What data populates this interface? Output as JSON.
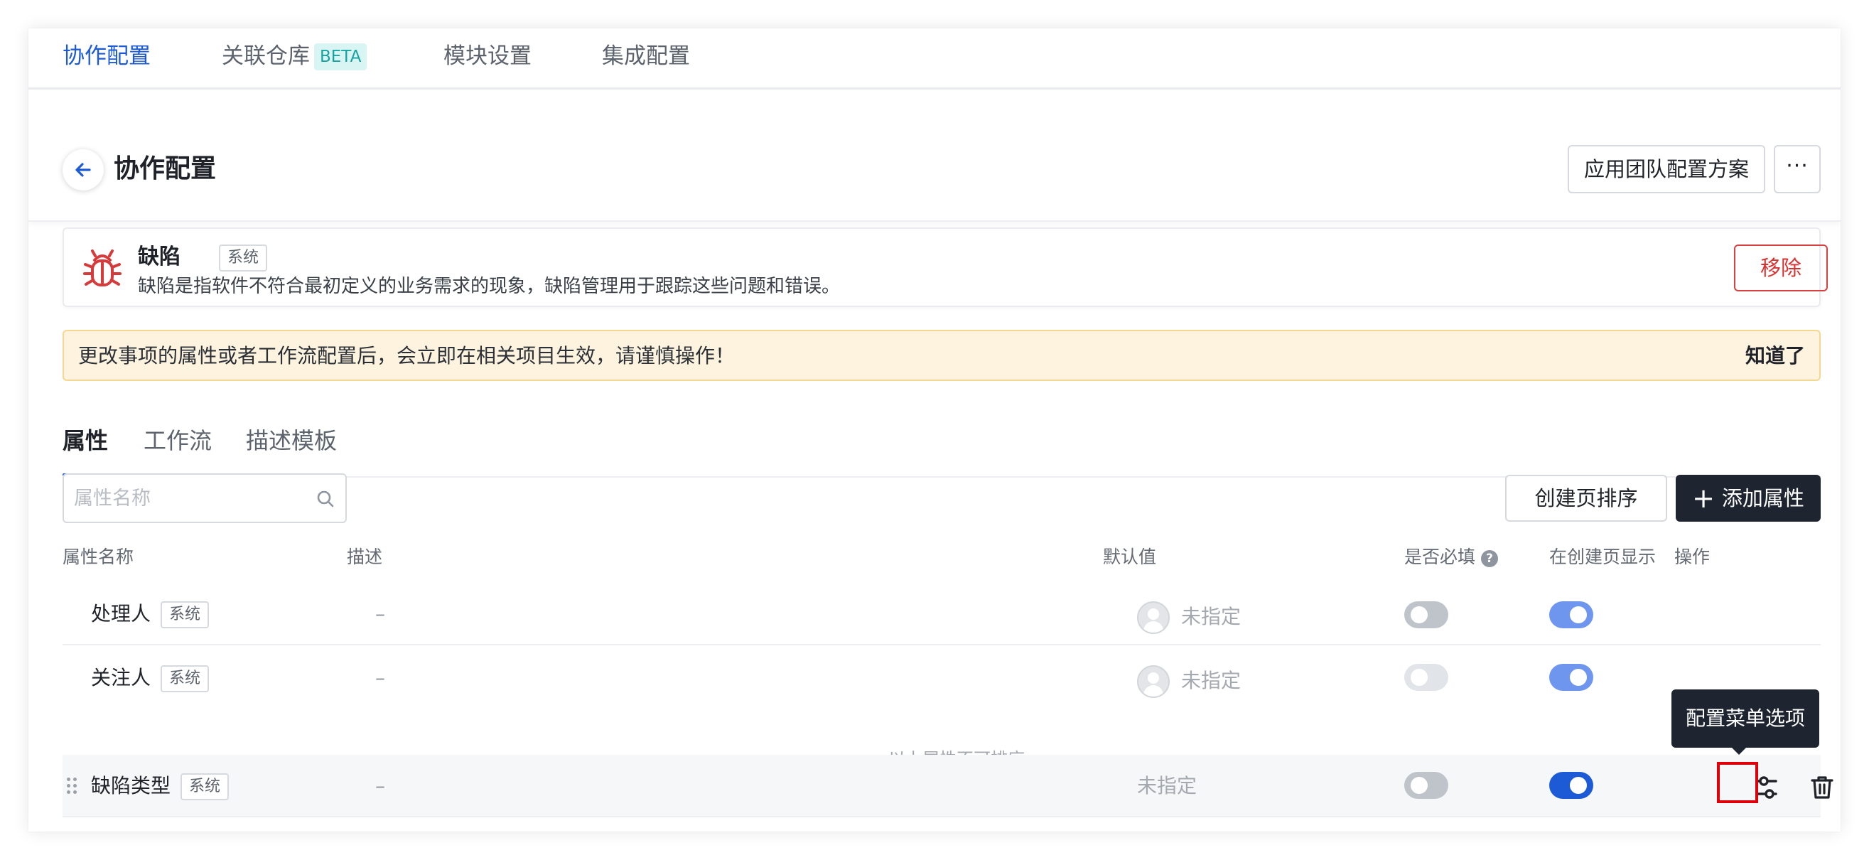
{
  "top_tabs": {
    "collab": "协作配置",
    "repo": "关联仓库",
    "repo_badge": "BETA",
    "modules": "模块设置",
    "integration": "集成配置"
  },
  "header": {
    "title": "协作配置",
    "apply_button": "应用团队配置方案",
    "more_button": "···"
  },
  "issue_type": {
    "name": "缺陷",
    "tag": "系统",
    "description": "缺陷是指软件不符合最初定义的业务需求的现象，缺陷管理用于跟踪这些问题和错误。",
    "remove_button": "移除",
    "icon": "bug-icon",
    "icon_color": "#d63a3a"
  },
  "warning": {
    "text": "更改事项的属性或者工作流配置后，会立即在相关项目生效，请谨慎操作！",
    "ok_button": "知道了"
  },
  "sub_tabs": {
    "attributes": "属性",
    "workflow": "工作流",
    "template": "描述模板"
  },
  "toolbar": {
    "search_placeholder": "属性名称",
    "sort_button": "创建页排序",
    "add_button": "添加属性",
    "add_icon": "plus-icon"
  },
  "table": {
    "headers": {
      "name": "属性名称",
      "description": "描述",
      "default": "默认值",
      "required": "是否必填",
      "show_on_create": "在创建页显示",
      "actions": "操作"
    },
    "rows": [
      {
        "name": "处理人",
        "tag": "系统",
        "description": "–",
        "default": "未指定",
        "required": false,
        "show_on_create": true
      },
      {
        "name": "关注人",
        "tag": "系统",
        "description": "–",
        "default": "未指定",
        "required": false,
        "show_on_create": true
      },
      {
        "name": "缺陷类型",
        "tag": "系统",
        "description": "–",
        "default": "未指定",
        "required": false,
        "show_on_create": true
      }
    ],
    "fixed_divider": "以上属性不可排序"
  },
  "tooltip": {
    "text": "配置菜单选项"
  },
  "colors": {
    "accent": "#1d5bd6",
    "danger": "#d93030",
    "warning_bg": "#fdf3de",
    "dark_button": "#1e2430",
    "highlight_box": "#e0000a"
  }
}
